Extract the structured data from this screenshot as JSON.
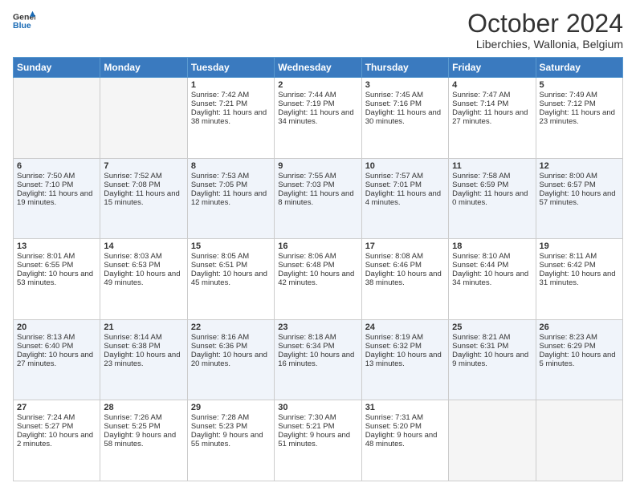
{
  "header": {
    "logo_line1": "General",
    "logo_line2": "Blue",
    "month": "October 2024",
    "location": "Liberchies, Wallonia, Belgium"
  },
  "days_of_week": [
    "Sunday",
    "Monday",
    "Tuesday",
    "Wednesday",
    "Thursday",
    "Friday",
    "Saturday"
  ],
  "weeks": [
    [
      {
        "day": "",
        "sunrise": "",
        "sunset": "",
        "daylight": ""
      },
      {
        "day": "",
        "sunrise": "",
        "sunset": "",
        "daylight": ""
      },
      {
        "day": "1",
        "sunrise": "Sunrise: 7:42 AM",
        "sunset": "Sunset: 7:21 PM",
        "daylight": "Daylight: 11 hours and 38 minutes."
      },
      {
        "day": "2",
        "sunrise": "Sunrise: 7:44 AM",
        "sunset": "Sunset: 7:19 PM",
        "daylight": "Daylight: 11 hours and 34 minutes."
      },
      {
        "day": "3",
        "sunrise": "Sunrise: 7:45 AM",
        "sunset": "Sunset: 7:16 PM",
        "daylight": "Daylight: 11 hours and 30 minutes."
      },
      {
        "day": "4",
        "sunrise": "Sunrise: 7:47 AM",
        "sunset": "Sunset: 7:14 PM",
        "daylight": "Daylight: 11 hours and 27 minutes."
      },
      {
        "day": "5",
        "sunrise": "Sunrise: 7:49 AM",
        "sunset": "Sunset: 7:12 PM",
        "daylight": "Daylight: 11 hours and 23 minutes."
      }
    ],
    [
      {
        "day": "6",
        "sunrise": "Sunrise: 7:50 AM",
        "sunset": "Sunset: 7:10 PM",
        "daylight": "Daylight: 11 hours and 19 minutes."
      },
      {
        "day": "7",
        "sunrise": "Sunrise: 7:52 AM",
        "sunset": "Sunset: 7:08 PM",
        "daylight": "Daylight: 11 hours and 15 minutes."
      },
      {
        "day": "8",
        "sunrise": "Sunrise: 7:53 AM",
        "sunset": "Sunset: 7:05 PM",
        "daylight": "Daylight: 11 hours and 12 minutes."
      },
      {
        "day": "9",
        "sunrise": "Sunrise: 7:55 AM",
        "sunset": "Sunset: 7:03 PM",
        "daylight": "Daylight: 11 hours and 8 minutes."
      },
      {
        "day": "10",
        "sunrise": "Sunrise: 7:57 AM",
        "sunset": "Sunset: 7:01 PM",
        "daylight": "Daylight: 11 hours and 4 minutes."
      },
      {
        "day": "11",
        "sunrise": "Sunrise: 7:58 AM",
        "sunset": "Sunset: 6:59 PM",
        "daylight": "Daylight: 11 hours and 0 minutes."
      },
      {
        "day": "12",
        "sunrise": "Sunrise: 8:00 AM",
        "sunset": "Sunset: 6:57 PM",
        "daylight": "Daylight: 10 hours and 57 minutes."
      }
    ],
    [
      {
        "day": "13",
        "sunrise": "Sunrise: 8:01 AM",
        "sunset": "Sunset: 6:55 PM",
        "daylight": "Daylight: 10 hours and 53 minutes."
      },
      {
        "day": "14",
        "sunrise": "Sunrise: 8:03 AM",
        "sunset": "Sunset: 6:53 PM",
        "daylight": "Daylight: 10 hours and 49 minutes."
      },
      {
        "day": "15",
        "sunrise": "Sunrise: 8:05 AM",
        "sunset": "Sunset: 6:51 PM",
        "daylight": "Daylight: 10 hours and 45 minutes."
      },
      {
        "day": "16",
        "sunrise": "Sunrise: 8:06 AM",
        "sunset": "Sunset: 6:48 PM",
        "daylight": "Daylight: 10 hours and 42 minutes."
      },
      {
        "day": "17",
        "sunrise": "Sunrise: 8:08 AM",
        "sunset": "Sunset: 6:46 PM",
        "daylight": "Daylight: 10 hours and 38 minutes."
      },
      {
        "day": "18",
        "sunrise": "Sunrise: 8:10 AM",
        "sunset": "Sunset: 6:44 PM",
        "daylight": "Daylight: 10 hours and 34 minutes."
      },
      {
        "day": "19",
        "sunrise": "Sunrise: 8:11 AM",
        "sunset": "Sunset: 6:42 PM",
        "daylight": "Daylight: 10 hours and 31 minutes."
      }
    ],
    [
      {
        "day": "20",
        "sunrise": "Sunrise: 8:13 AM",
        "sunset": "Sunset: 6:40 PM",
        "daylight": "Daylight: 10 hours and 27 minutes."
      },
      {
        "day": "21",
        "sunrise": "Sunrise: 8:14 AM",
        "sunset": "Sunset: 6:38 PM",
        "daylight": "Daylight: 10 hours and 23 minutes."
      },
      {
        "day": "22",
        "sunrise": "Sunrise: 8:16 AM",
        "sunset": "Sunset: 6:36 PM",
        "daylight": "Daylight: 10 hours and 20 minutes."
      },
      {
        "day": "23",
        "sunrise": "Sunrise: 8:18 AM",
        "sunset": "Sunset: 6:34 PM",
        "daylight": "Daylight: 10 hours and 16 minutes."
      },
      {
        "day": "24",
        "sunrise": "Sunrise: 8:19 AM",
        "sunset": "Sunset: 6:32 PM",
        "daylight": "Daylight: 10 hours and 13 minutes."
      },
      {
        "day": "25",
        "sunrise": "Sunrise: 8:21 AM",
        "sunset": "Sunset: 6:31 PM",
        "daylight": "Daylight: 10 hours and 9 minutes."
      },
      {
        "day": "26",
        "sunrise": "Sunrise: 8:23 AM",
        "sunset": "Sunset: 6:29 PM",
        "daylight": "Daylight: 10 hours and 5 minutes."
      }
    ],
    [
      {
        "day": "27",
        "sunrise": "Sunrise: 7:24 AM",
        "sunset": "Sunset: 5:27 PM",
        "daylight": "Daylight: 10 hours and 2 minutes."
      },
      {
        "day": "28",
        "sunrise": "Sunrise: 7:26 AM",
        "sunset": "Sunset: 5:25 PM",
        "daylight": "Daylight: 9 hours and 58 minutes."
      },
      {
        "day": "29",
        "sunrise": "Sunrise: 7:28 AM",
        "sunset": "Sunset: 5:23 PM",
        "daylight": "Daylight: 9 hours and 55 minutes."
      },
      {
        "day": "30",
        "sunrise": "Sunrise: 7:30 AM",
        "sunset": "Sunset: 5:21 PM",
        "daylight": "Daylight: 9 hours and 51 minutes."
      },
      {
        "day": "31",
        "sunrise": "Sunrise: 7:31 AM",
        "sunset": "Sunset: 5:20 PM",
        "daylight": "Daylight: 9 hours and 48 minutes."
      },
      {
        "day": "",
        "sunrise": "",
        "sunset": "",
        "daylight": ""
      },
      {
        "day": "",
        "sunrise": "",
        "sunset": "",
        "daylight": ""
      }
    ]
  ]
}
